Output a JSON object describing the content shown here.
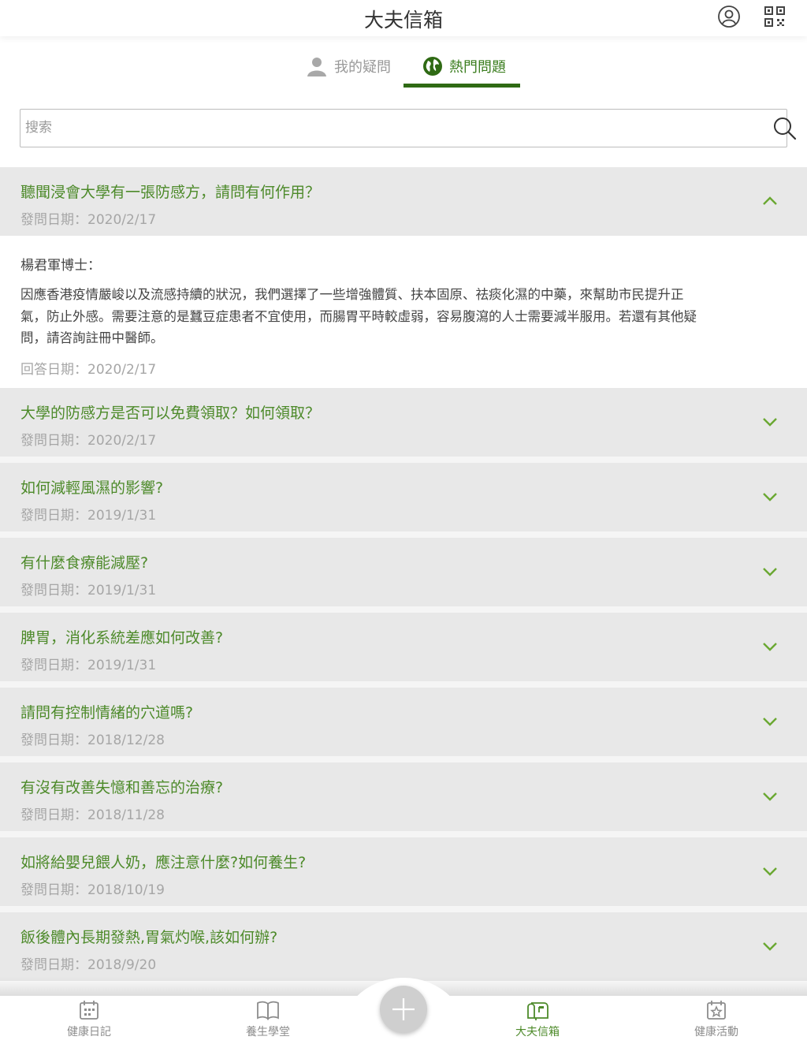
{
  "header": {
    "title": "大夫信箱"
  },
  "tabs": [
    {
      "label": "我的疑問",
      "active": false
    },
    {
      "label": "熱門問題",
      "active": true
    }
  ],
  "search": {
    "placeholder": "搜索",
    "value": ""
  },
  "expanded_question": {
    "title": "聽聞浸會大學有一張防感方，請問有何作用？",
    "date": "發問日期：2020/2/17",
    "answer_author": "楊君軍博士：",
    "answer_body": "因應香港疫情嚴峻以及流感持續的狀況，我們選擇了一些增強體質、扶本固原、祛痰化濕的中藥，來幫助市民提升正氣，防止外感。需要注意的是蠶豆症患者不宜使用，而腸胃平時較虛弱，容易腹瀉的人士需要減半服用。若還有其他疑問，請咨詢註冊中醫師。",
    "answer_date": "回答日期：2020/2/17"
  },
  "questions": [
    {
      "title": "大學的防感方是否可以免費領取？如何領取？",
      "date": "發問日期：2020/2/17"
    },
    {
      "title": "如何減輕風濕的影響?",
      "date": "發問日期：2019/1/31"
    },
    {
      "title": "有什麼食療能減壓?",
      "date": "發問日期：2019/1/31"
    },
    {
      "title": "脾胃，消化系統差應如何改善?",
      "date": "發問日期：2019/1/31"
    },
    {
      "title": "請問有控制情緒的穴道嗎?",
      "date": "發問日期：2018/12/28"
    },
    {
      "title": "有沒有改善失憶和善忘的治療?",
      "date": "發問日期：2018/11/28"
    },
    {
      "title": "如將給嬰兒餵人奶，應注意什麼?如何養生?",
      "date": "發問日期：2018/10/19"
    },
    {
      "title": "飯後體內長期發熱,胃氣灼喉,該如何辦?",
      "date": "發問日期：2018/9/20"
    }
  ],
  "bottom_nav": [
    {
      "label": "健康日記",
      "icon": "calendar-icon",
      "active": false
    },
    {
      "label": "養生學堂",
      "icon": "book-icon",
      "active": false
    },
    {
      "label": "大夫信箱",
      "icon": "mailbox-icon",
      "active": true
    },
    {
      "label": "健康活動",
      "icon": "event-star-icon",
      "active": false
    }
  ],
  "colors": {
    "accent": "#4d8a2a",
    "tab_underline": "#2f6a14",
    "row_bg": "#e8e8e8",
    "muted": "#a6a6a6"
  }
}
